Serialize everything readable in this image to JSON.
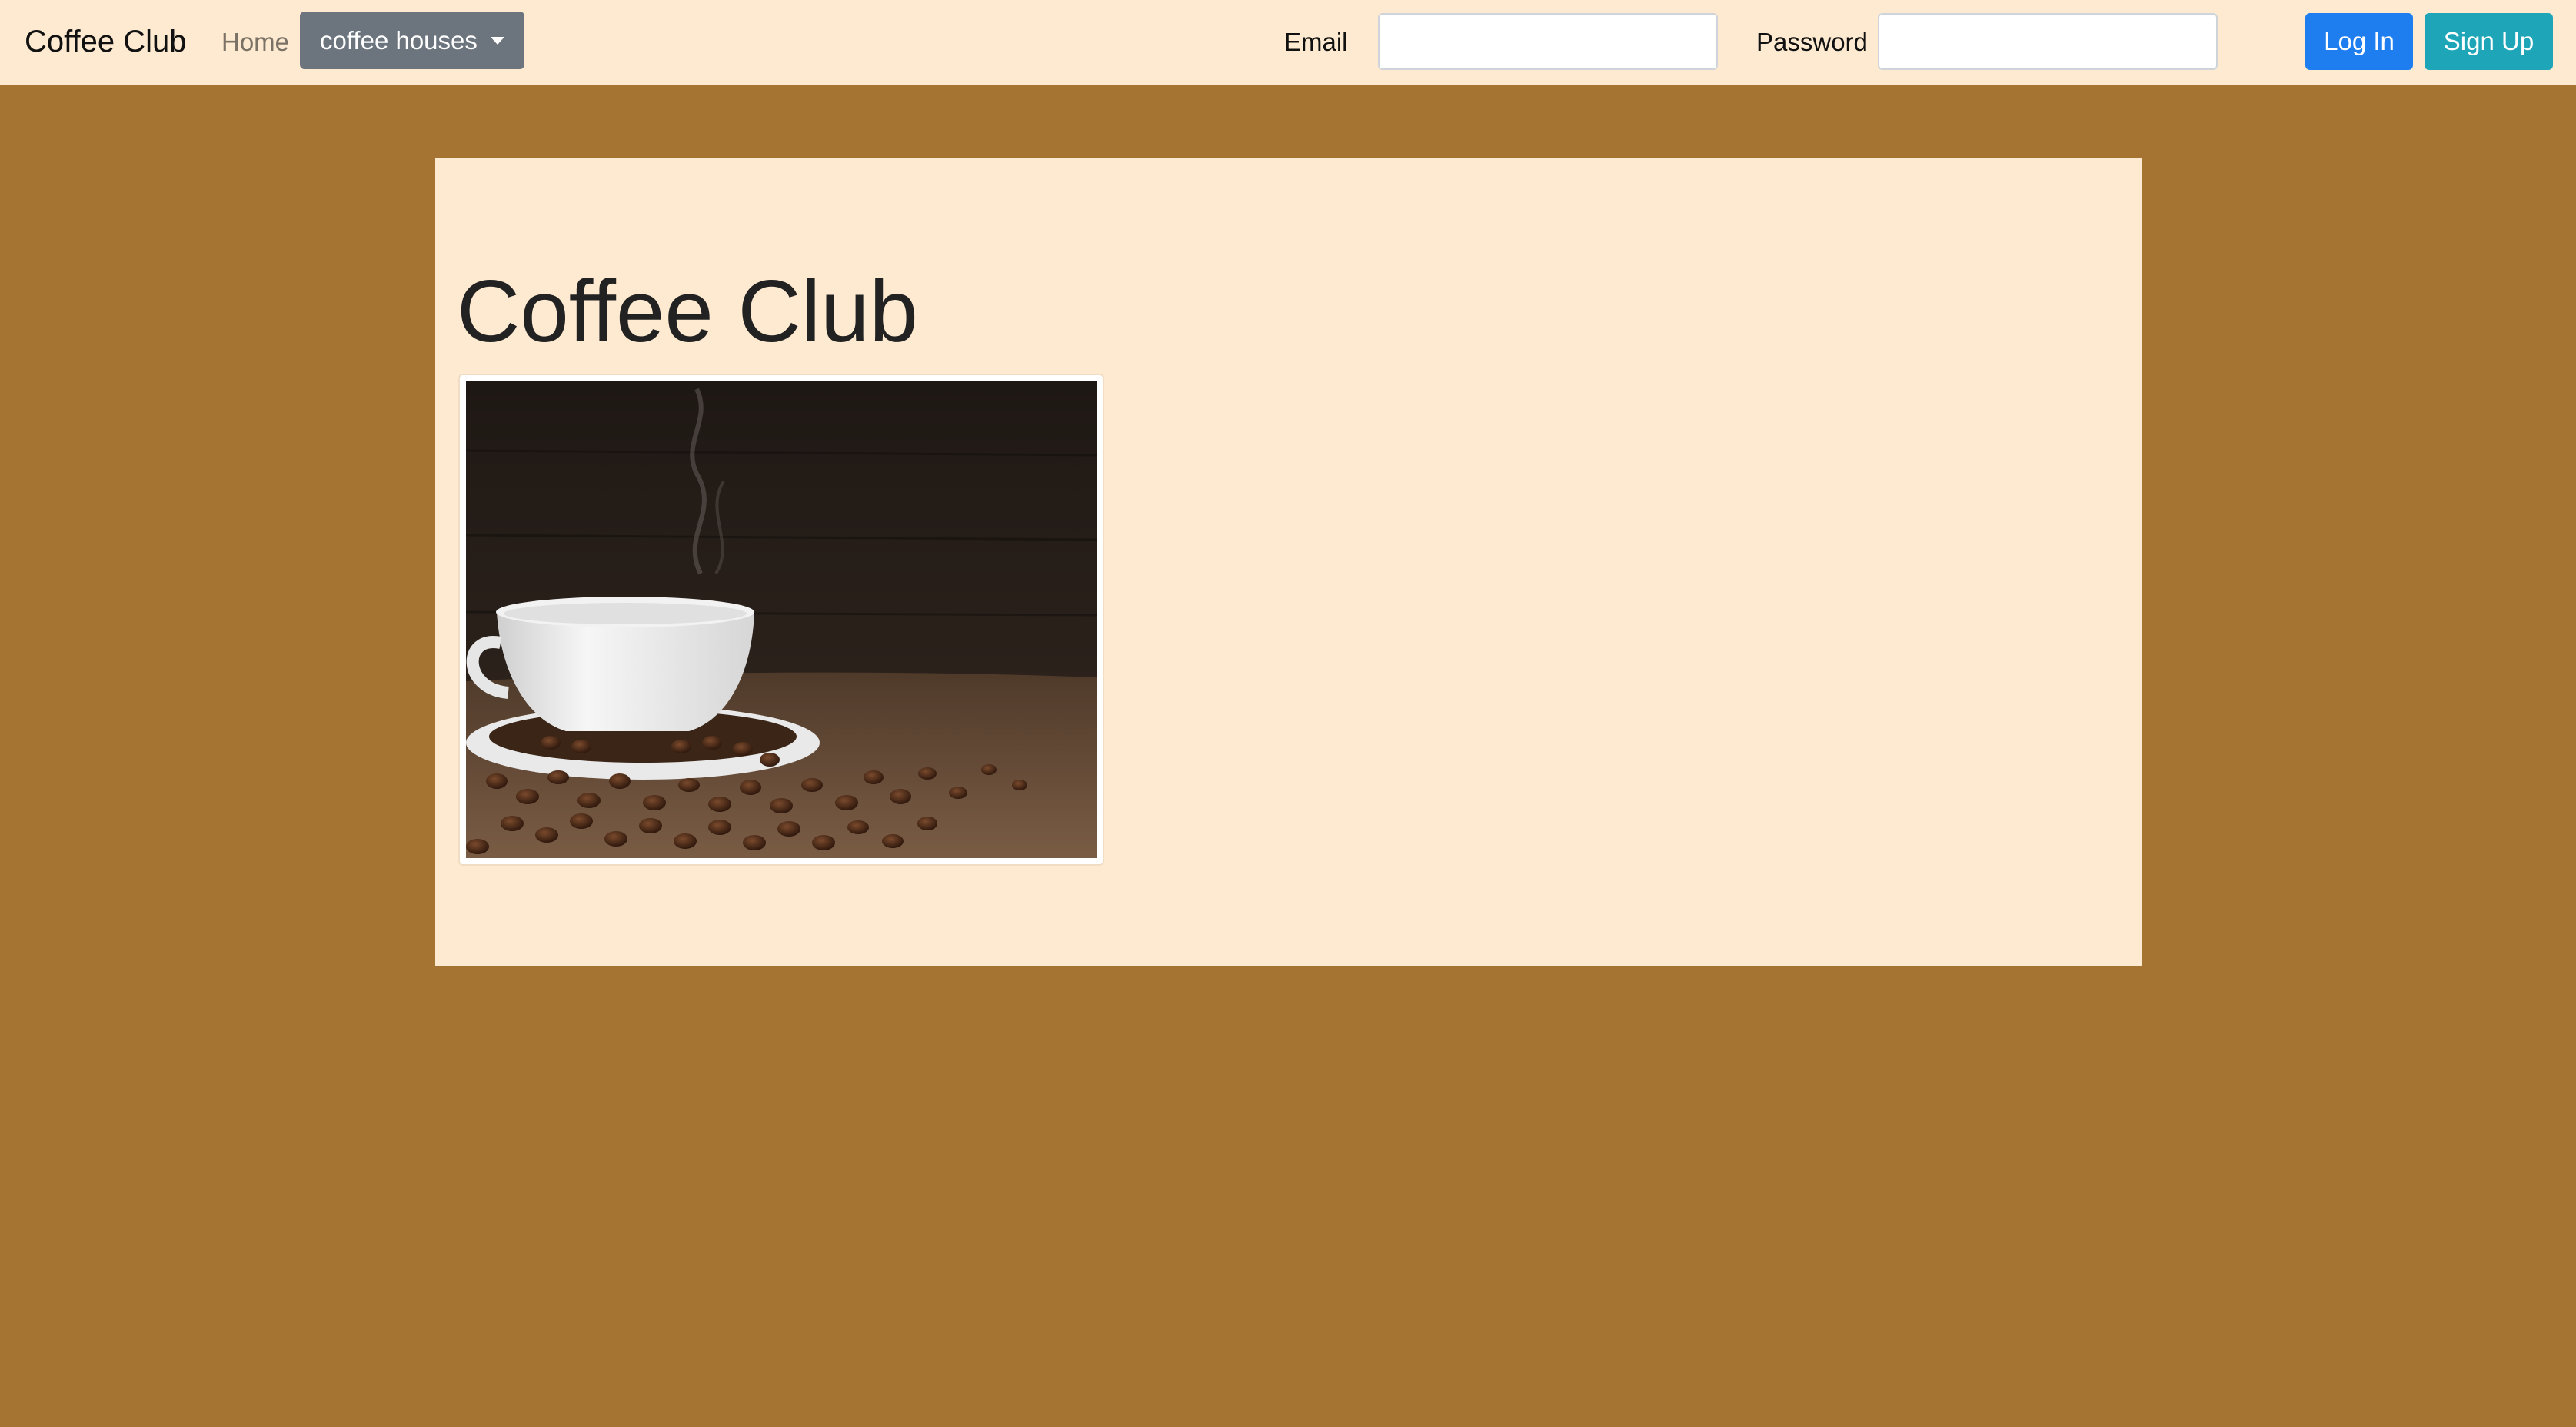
{
  "navbar": {
    "brand": "Coffee Club",
    "home_link": "Home",
    "dropdown_label": "coffee houses",
    "email_label": "Email",
    "email_value": "",
    "password_label": "Password",
    "password_value": "",
    "login_button": "Log In",
    "signup_button": "Sign Up"
  },
  "main": {
    "title": "Coffee Club",
    "image": "coffee-cup-on-beans-photo"
  },
  "colors": {
    "page_background": "#a57433",
    "panel_background": "#fdead0",
    "primary_button": "#1e7ef0",
    "info_button": "#1ea6b8",
    "secondary_button": "#6c757d"
  }
}
